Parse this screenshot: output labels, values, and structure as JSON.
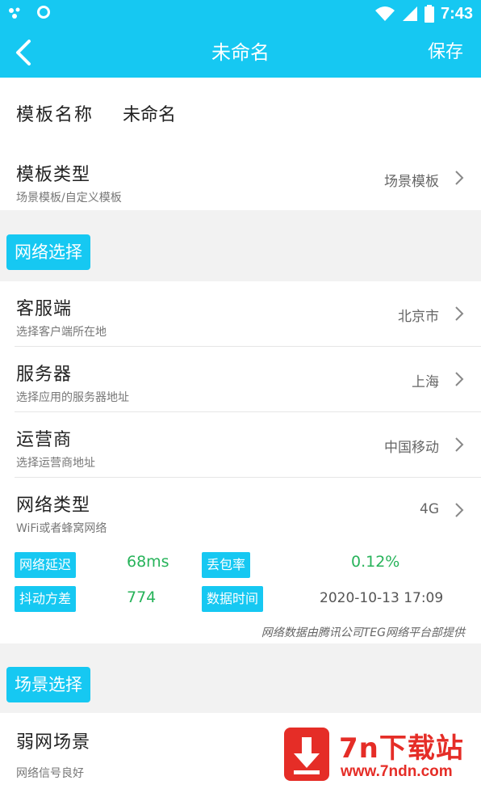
{
  "status_bar": {
    "time": "7:43"
  },
  "header": {
    "title": "未命名",
    "save_label": "保存"
  },
  "template": {
    "name_label": "模板名称",
    "name_value": "未命名",
    "type_label": "模板类型",
    "type_sub": "场景模板/自定义模板",
    "type_value": "场景模板"
  },
  "network_section": {
    "tag": "网络选择",
    "rows": [
      {
        "label": "客服端",
        "sub": "选择客户端所在地",
        "value": "北京市"
      },
      {
        "label": "服务器",
        "sub": "选择应用的服务器地址",
        "value": "上海"
      },
      {
        "label": "运营商",
        "sub": "选择运营商地址",
        "value": "中国移动"
      },
      {
        "label": "网络类型",
        "sub": "WiFi或者蜂窝网络",
        "value": "4G"
      }
    ],
    "metrics": {
      "latency_label": "网络延迟",
      "latency_value": "68ms",
      "loss_label": "丢包率",
      "loss_value": "0.12%",
      "jitter_label": "抖动方差",
      "jitter_value": "774",
      "time_label": "数据时间",
      "time_value": "2020-10-13 17:09"
    },
    "note": "网络数据由腾讯公司TEG网络平台部提供"
  },
  "scene_section": {
    "tag": "场景选择",
    "row": {
      "label": "弱网场景",
      "sub": "网络信号良好"
    }
  },
  "watermark": {
    "title": "7n下载站",
    "url": "www.7ndn.com"
  },
  "colors": {
    "accent": "#16c8f2",
    "metric_value": "#27b35a",
    "watermark": "#e52d27"
  }
}
